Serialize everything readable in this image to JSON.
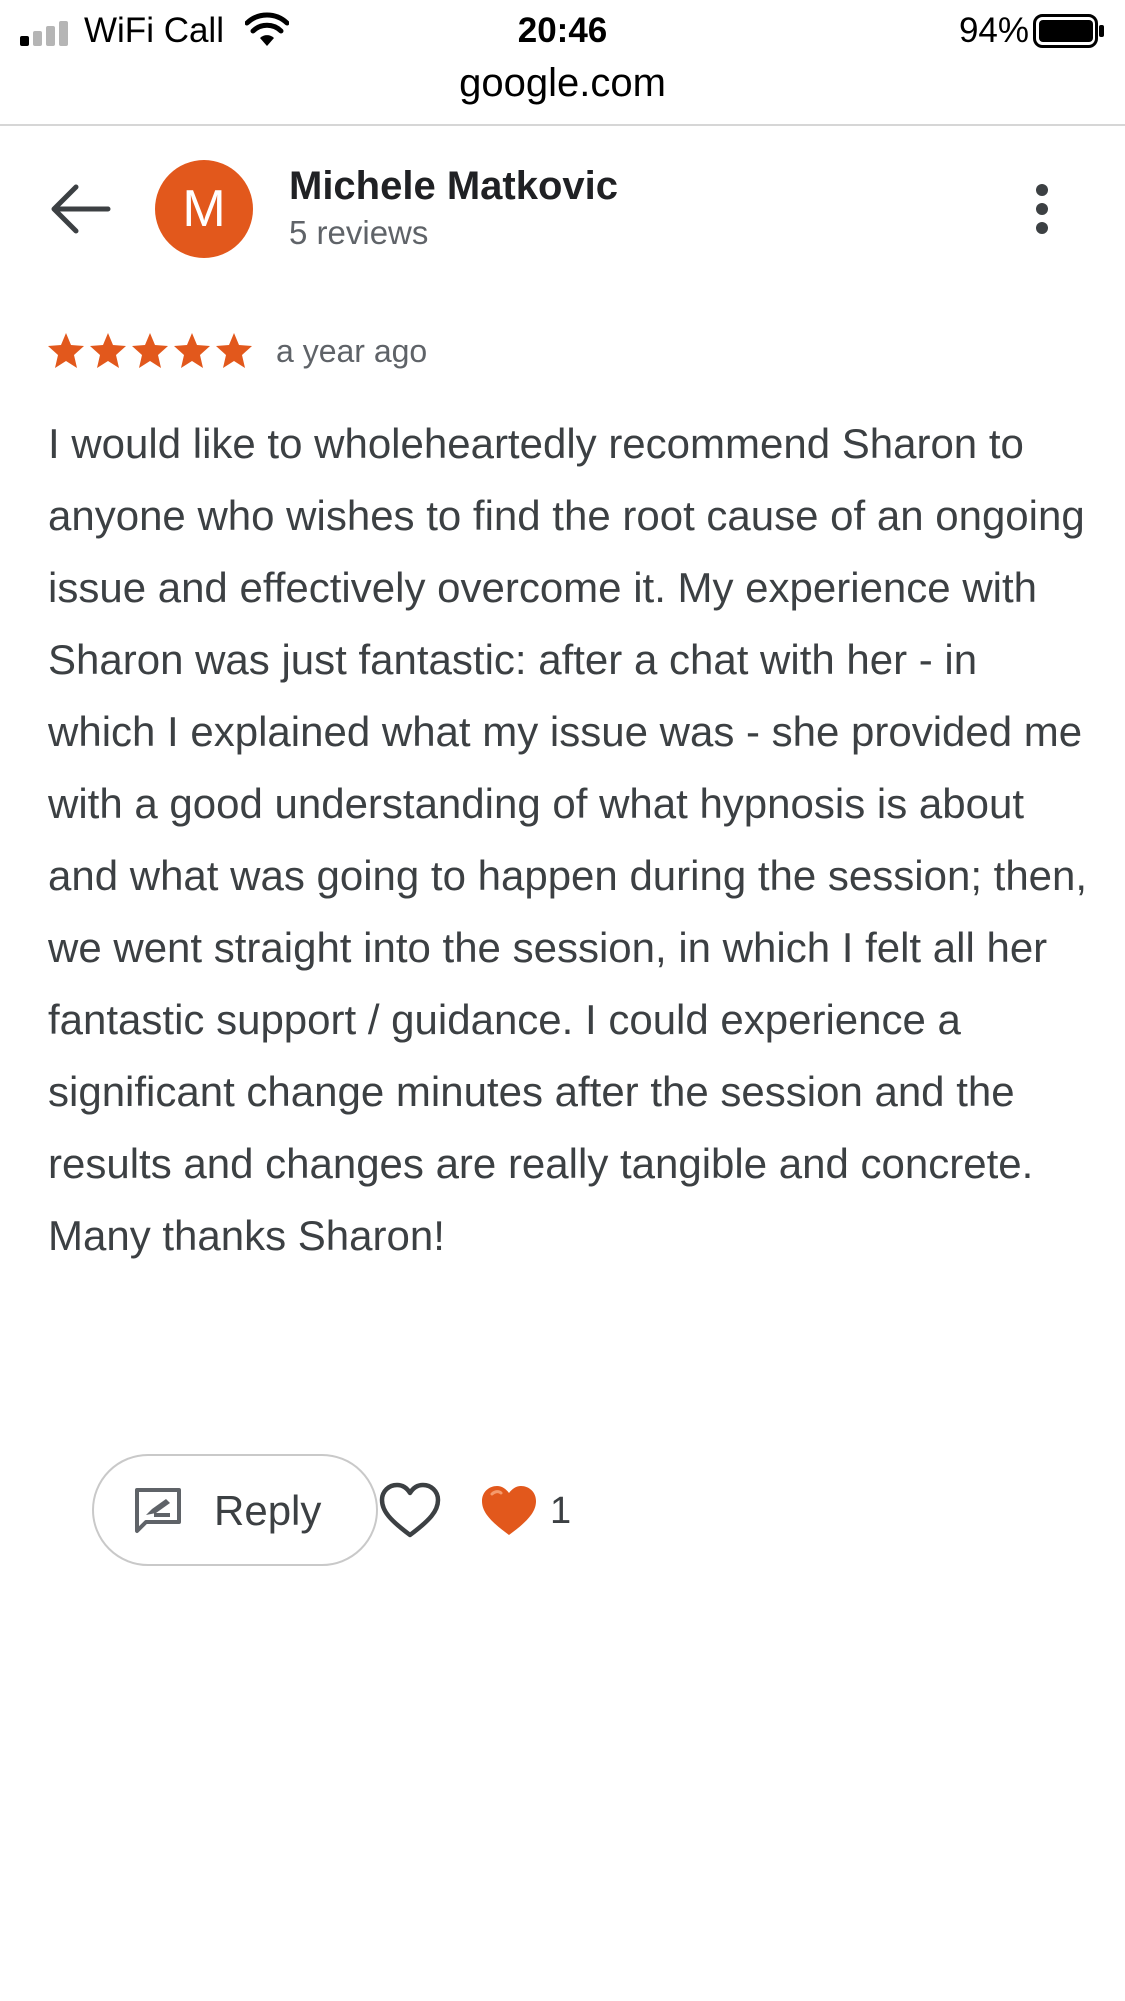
{
  "status_bar": {
    "carrier": "WiFi Call",
    "time": "20:46",
    "battery_percent": "94%",
    "icons": [
      "signal-icon",
      "wifi-icon",
      "battery-icon"
    ]
  },
  "browser": {
    "url": "google.com"
  },
  "header": {
    "avatar_initial": "M",
    "reviewer_name": "Michele Matkovic",
    "review_count": "5 reviews",
    "icons": [
      "back-arrow-icon",
      "more-vert-icon"
    ]
  },
  "review": {
    "rating": 5,
    "rating_max": 5,
    "time_ago": "a year ago",
    "text": "I would like to wholeheartedly recommend Sharon to anyone who wishes to find the root cause of an ongoing issue and effectively overcome it. My experience with Sharon was just fantastic: after a chat with her - in which I explained what my issue was - she provided me with a good understanding of what hypnosis is about and what was going to happen during the session; then, we went straight into the session, in which I felt all her fantastic support / guidance. I could experience a significant change minutes after the session and the results and changes are really tangible and concrete. Many thanks Sharon!"
  },
  "actions": {
    "reply_label": "Reply",
    "reaction_count": "1",
    "icons": [
      "reply-icon",
      "heart-outline-icon",
      "heart-filled-icon"
    ]
  },
  "colors": {
    "accent": "#e2581c",
    "star": "#e2581c",
    "text_primary": "#202124",
    "text_secondary": "#5f6368",
    "body_text": "#3c4043"
  }
}
